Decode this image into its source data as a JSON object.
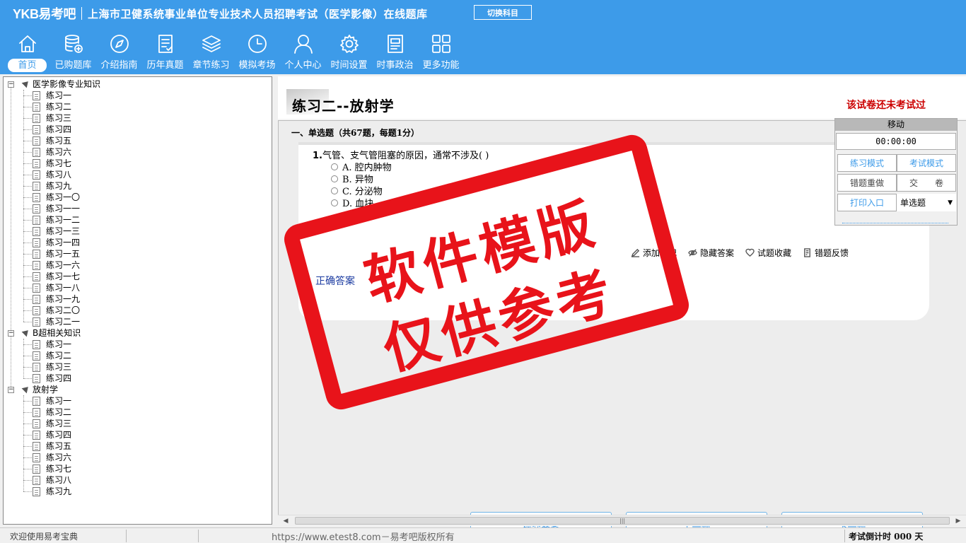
{
  "header": {
    "logo": "YKB易考吧",
    "title": "上海市卫健系统事业单位专业技术人员招聘考试（医学影像）在线题库",
    "switch_label": "切换科目"
  },
  "nav": {
    "items": [
      {
        "label": "首页",
        "icon": "home-icon"
      },
      {
        "label": "已购题库",
        "icon": "database-icon"
      },
      {
        "label": "介绍指南",
        "icon": "compass-icon"
      },
      {
        "label": "历年真题",
        "icon": "checklist-icon"
      },
      {
        "label": "章节练习",
        "icon": "layers-icon"
      },
      {
        "label": "模拟考场",
        "icon": "clock-icon"
      },
      {
        "label": "个人中心",
        "icon": "user-icon"
      },
      {
        "label": "时间设置",
        "icon": "gear-icon"
      },
      {
        "label": "时事政治",
        "icon": "news-icon"
      },
      {
        "label": "更多功能",
        "icon": "grid-icon"
      }
    ]
  },
  "tree": {
    "groups": [
      {
        "label": "医学影像专业知识",
        "items": [
          "练习一",
          "练习二",
          "练习三",
          "练习四",
          "练习五",
          "练习六",
          "练习七",
          "练习八",
          "练习九",
          "练习一〇",
          "练习一一",
          "练习一二",
          "练习一三",
          "练习一四",
          "练习一五",
          "练习一六",
          "练习一七",
          "练习一八",
          "练习一九",
          "练习二〇",
          "练习二一"
        ]
      },
      {
        "label": "B超相关知识",
        "items": [
          "练习一",
          "练习二",
          "练习三",
          "练习四"
        ]
      },
      {
        "label": "放射学",
        "items": [
          "练习一",
          "练习二",
          "练习三",
          "练习四",
          "练习五",
          "练习六",
          "练习七",
          "练习八",
          "练习九"
        ]
      }
    ]
  },
  "paper": {
    "title": "练习二--放射学",
    "status": "该试卷还未考试过",
    "section_title": "一、单选题（共67题，每题1分）"
  },
  "question": {
    "number": "1.",
    "stem": "气管、支气管阻塞的原因，通常不涉及( )",
    "options": [
      "A. 腔内肿物",
      "B. 异物",
      "C. 分泌物",
      "D. 血块"
    ],
    "actions": {
      "add_note": "添加笔记",
      "hide_answer": "隐藏答案",
      "favorite": "试题收藏",
      "feedback": "错题反馈"
    },
    "answer_label": "正确答案"
  },
  "buttons": {
    "submit": "提交答案",
    "prev": "上一题",
    "next": "下一题"
  },
  "tool_panel": {
    "move": "移动",
    "timer": "00:00:00",
    "practice_mode": "练习模式",
    "exam_mode": "考试模式",
    "redo_wrong": "错题重做",
    "hand_in": "交　　卷",
    "print": "打印入口",
    "question_type": "单选题"
  },
  "statusbar": {
    "welcome": "欢迎使用易考宝典",
    "copyright": "https://www.etest8.com－易考吧版权所有",
    "countdown": "考试倒计时 000 天"
  },
  "watermark": {
    "line1": "软件模版",
    "line2": "仅供参考"
  },
  "colors": {
    "header_bg": "#3d9be9",
    "stamp_red": "#e8131a",
    "status_red": "#cc0000"
  }
}
